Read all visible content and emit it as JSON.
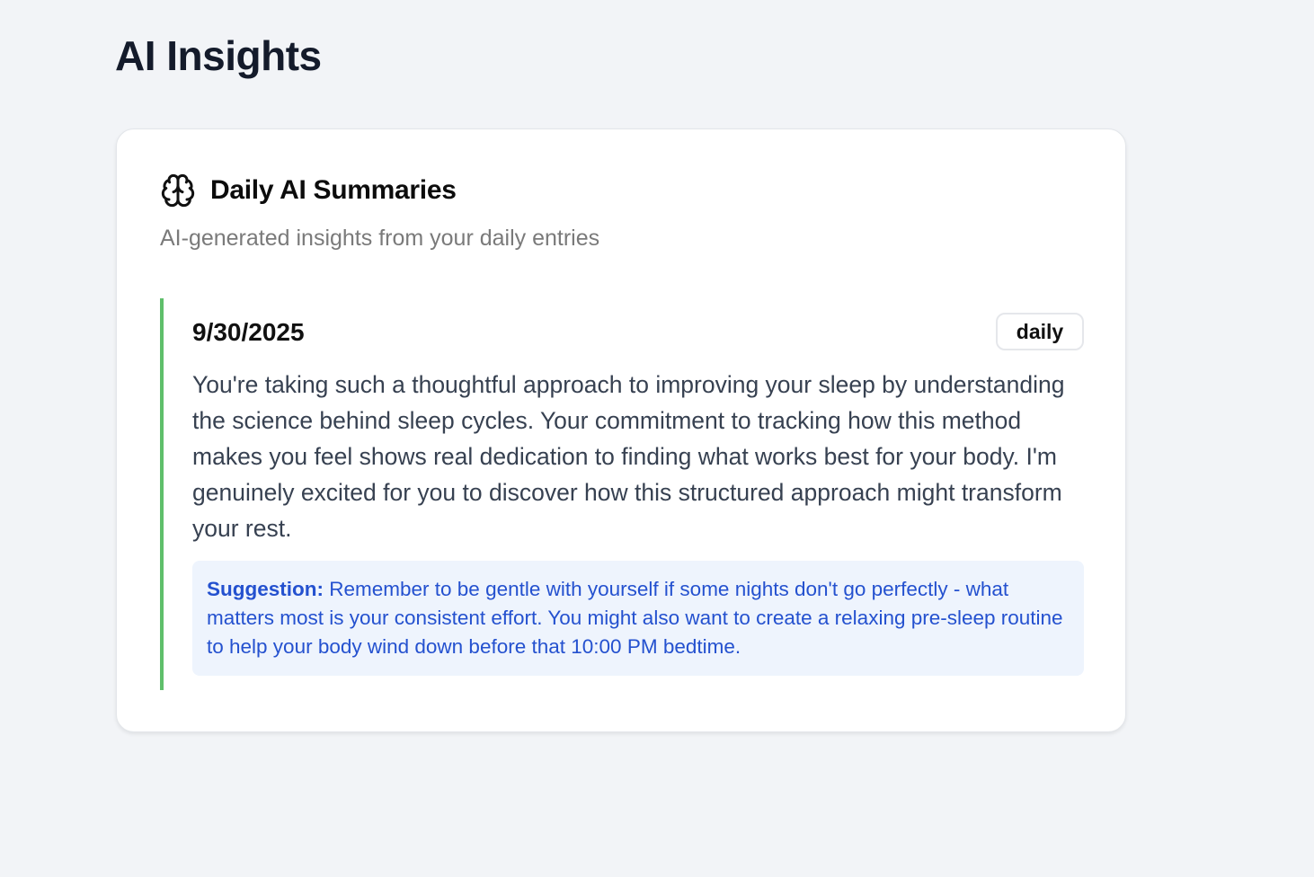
{
  "page": {
    "title": "AI Insights"
  },
  "card": {
    "icon": "brain-icon",
    "title": "Daily AI Summaries",
    "subtitle": "AI-generated insights from your daily entries"
  },
  "entries": [
    {
      "date": "9/30/2025",
      "badge": "daily",
      "summary": "You're taking such a thoughtful approach to improving your sleep by understanding the science behind sleep cycles. Your commitment to tracking how this method makes you feel shows real dedication to finding what works best for your body. I'm genuinely excited for you to discover how this structured approach might transform your rest.",
      "suggestion_label": "Suggestion:",
      "suggestion_text": " Remember to be gentle with yourself if some nights don't go perfectly - what matters most is your consistent effort. You might also want to create a relaxing pre-sleep routine to help your body wind down before that 10:00 PM bedtime."
    }
  ],
  "colors": {
    "background": "#f2f4f7",
    "accent_border": "#5fbf6b",
    "suggestion_bg": "#eef4fd",
    "suggestion_text": "#2451cf"
  }
}
